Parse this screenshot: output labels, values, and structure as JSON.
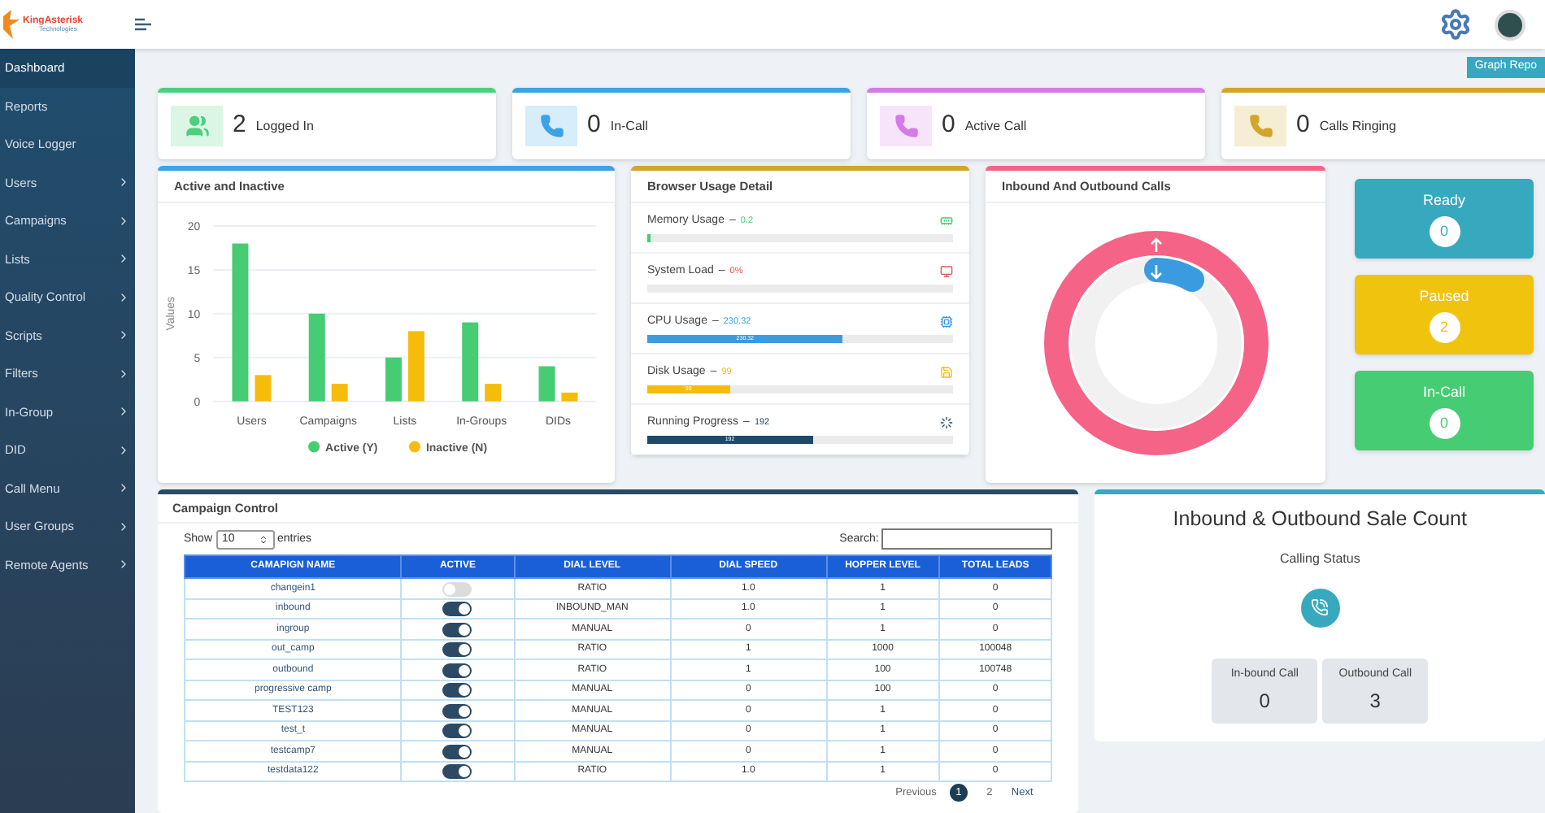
{
  "header": {
    "logo_title": "KingAsterisk",
    "logo_subtitle": "Technologies"
  },
  "sidebar": {
    "items": [
      {
        "label": "Dashboard",
        "selected": true,
        "kind": "link"
      },
      {
        "label": "Reports",
        "selected": false,
        "kind": "link"
      },
      {
        "label": "Voice Logger",
        "selected": false,
        "kind": "link"
      },
      {
        "label": "Users",
        "selected": false,
        "kind": "menu"
      },
      {
        "label": "Campaigns",
        "selected": false,
        "kind": "menu"
      },
      {
        "label": "Lists",
        "selected": false,
        "kind": "menu"
      },
      {
        "label": "Quality Control",
        "selected": false,
        "kind": "menu"
      },
      {
        "label": "Scripts",
        "selected": false,
        "kind": "menu"
      },
      {
        "label": "Filters",
        "selected": false,
        "kind": "menu"
      },
      {
        "label": "In-Group",
        "selected": false,
        "kind": "menu"
      },
      {
        "label": "DID",
        "selected": false,
        "kind": "menu"
      },
      {
        "label": "Call Menu",
        "selected": false,
        "kind": "menu"
      },
      {
        "label": "User Groups",
        "selected": false,
        "kind": "menu"
      },
      {
        "label": "Remote Agents",
        "selected": false,
        "kind": "menu"
      }
    ]
  },
  "graph_report_button": "Graph Repo",
  "stat_cards": [
    {
      "count": "2",
      "label": "Logged In",
      "kind": "users",
      "color": "#4cd07d"
    },
    {
      "count": "0",
      "label": "In-Call",
      "kind": "phone",
      "color": "#3ba3e6"
    },
    {
      "count": "0",
      "label": "Active Call",
      "kind": "phone",
      "color": "#d67ae8"
    },
    {
      "count": "0",
      "label": "Calls Ringing",
      "kind": "phone",
      "color": "#d4a52b"
    }
  ],
  "active_inactive": {
    "title": "Active and Inactive",
    "chart_data": {
      "type": "bar",
      "ylabel": "Values",
      "categories": [
        "Users",
        "Campaigns",
        "Lists",
        "In-Groups",
        "DIDs"
      ],
      "series": [
        {
          "name": "Active (Y)",
          "color": "#46cc73",
          "values": [
            18,
            10,
            5,
            9,
            4
          ]
        },
        {
          "name": "Inactive (N)",
          "color": "#f5bd0a",
          "values": [
            3,
            2,
            8,
            2,
            1
          ]
        }
      ],
      "ylim": [
        0,
        20
      ],
      "yticks": [
        0,
        5,
        10,
        15,
        20
      ],
      "grid": true,
      "legend": true
    }
  },
  "browser_usage": {
    "title": "Browser Usage Detail",
    "items": [
      {
        "label": "Memory Usage",
        "separator": "–",
        "value": "0.2",
        "level": 0.01,
        "color": "#46cc73"
      },
      {
        "label": "System Load",
        "separator": "–",
        "value": "0%",
        "level": 0,
        "color": "#e5534b"
      },
      {
        "label": "CPU Usage",
        "separator": "–",
        "value": "230.32",
        "level": 0.64,
        "color": "#3b9be0",
        "bar_label": "230.32"
      },
      {
        "label": "Disk Usage",
        "separator": "–",
        "value": "99",
        "level": 0.27,
        "color": "#f5bd0a",
        "bar_label": "99"
      },
      {
        "label": "Running Progress",
        "separator": "–",
        "value": "192",
        "level": 0.54,
        "color": "#1d4a6b",
        "bar_label": "192"
      }
    ]
  },
  "inbound_outbound": {
    "title": "Inbound And Outbound Calls"
  },
  "status_tiles": [
    {
      "label": "Ready",
      "count": "0",
      "color": "#36a9bf"
    },
    {
      "label": "Paused",
      "count": "2",
      "color": "#f0c30f"
    },
    {
      "label": "In-Call",
      "count": "0",
      "color": "#46cc73"
    }
  ],
  "campaign_control": {
    "title": "Campaign Control",
    "show_label": "Show",
    "page_size": "10",
    "entries_label": "entries",
    "search_label": "Search:",
    "columns": [
      "CAMAPIGN NAME",
      "ACTIVE",
      "DIAL LEVEL",
      "DIAL SPEED",
      "HOPPER LEVEL",
      "TOTAL LEADS"
    ],
    "rows": [
      {
        "name": "changein1",
        "active": false,
        "dial_level": "RATIO",
        "dial_speed": "1.0",
        "hopper_level": "1",
        "total_leads": "0"
      },
      {
        "name": "inbound",
        "active": true,
        "dial_level": "INBOUND_MAN",
        "dial_speed": "1.0",
        "hopper_level": "1",
        "total_leads": "0"
      },
      {
        "name": "ingroup",
        "active": true,
        "dial_level": "MANUAL",
        "dial_speed": "0",
        "hopper_level": "1",
        "total_leads": "0"
      },
      {
        "name": "out_camp",
        "active": true,
        "dial_level": "RATIO",
        "dial_speed": "1",
        "hopper_level": "1000",
        "total_leads": "100048"
      },
      {
        "name": "outbound",
        "active": true,
        "dial_level": "RATIO",
        "dial_speed": "1",
        "hopper_level": "100",
        "total_leads": "100748"
      },
      {
        "name": "progressive camp",
        "active": true,
        "dial_level": "MANUAL",
        "dial_speed": "0",
        "hopper_level": "100",
        "total_leads": "0"
      },
      {
        "name": "TEST123",
        "active": true,
        "dial_level": "MANUAL",
        "dial_speed": "0",
        "hopper_level": "1",
        "total_leads": "0"
      },
      {
        "name": "test_t",
        "active": true,
        "dial_level": "MANUAL",
        "dial_speed": "0",
        "hopper_level": "1",
        "total_leads": "0"
      },
      {
        "name": "testcamp7",
        "active": true,
        "dial_level": "MANUAL",
        "dial_speed": "0",
        "hopper_level": "1",
        "total_leads": "0"
      },
      {
        "name": "testdata122",
        "active": true,
        "dial_level": "RATIO",
        "dial_speed": "1.0",
        "hopper_level": "1",
        "total_leads": "0"
      }
    ],
    "pagination": {
      "previous": "Previous",
      "pages": [
        {
          "label": "1",
          "selected": true
        },
        {
          "label": "2",
          "selected": false
        }
      ],
      "next": "Next"
    }
  },
  "sale_count": {
    "title": "Inbound & Outbound Sale Count",
    "subtitle": "Calling Status",
    "boxes": [
      {
        "label": "In-bound Call",
        "count": "0"
      },
      {
        "label": "Outbound Call",
        "count": "3"
      }
    ]
  }
}
